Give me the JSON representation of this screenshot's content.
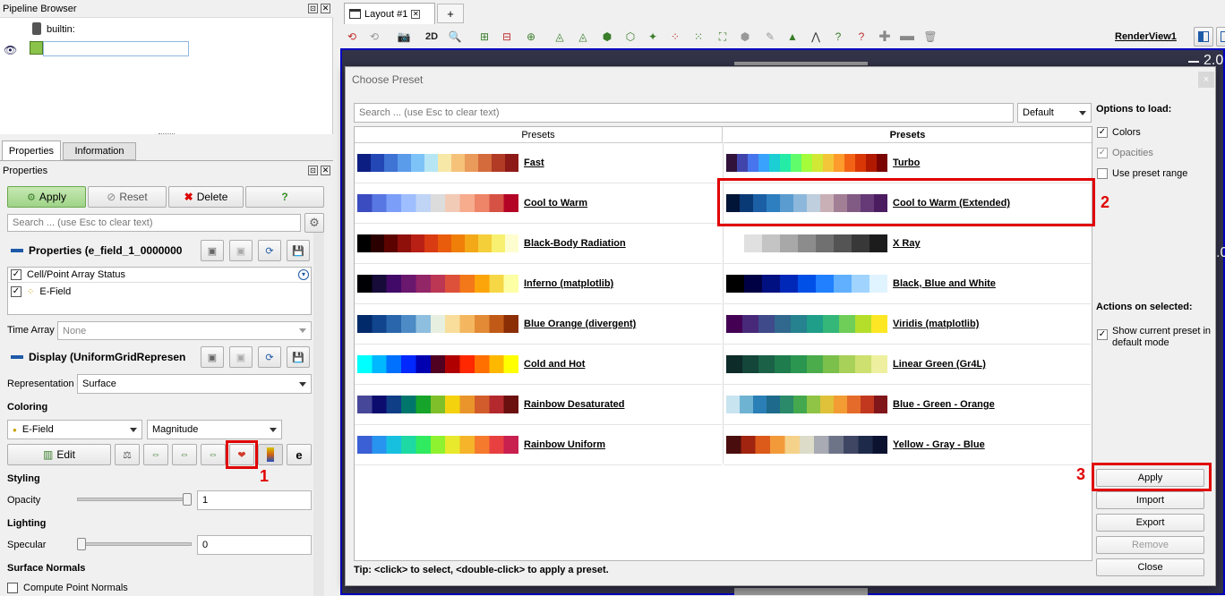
{
  "pipeline": {
    "title": "Pipeline Browser",
    "builtin": "builtin:"
  },
  "tabs": {
    "properties": "Properties",
    "information": "Information"
  },
  "props": {
    "title": "Properties",
    "apply": "Apply",
    "reset": "Reset",
    "delete": "Delete",
    "help": "?",
    "search_placeholder": "Search ... (use Esc to clear text)",
    "section_props": "Properties (e_field_1_0000000",
    "array_status": "Cell/Point Array Status",
    "efield": "E-Field",
    "time_array_label": "Time Array",
    "time_array_value": "None",
    "section_display": "Display (UniformGridRepresen",
    "representation_label": "Representation",
    "representation_value": "Surface",
    "coloring": "Coloring",
    "color_by": "E-Field",
    "component": "Magnitude",
    "edit": "Edit",
    "styling": "Styling",
    "opacity_label": "Opacity",
    "opacity_value": "1",
    "opacity_level": 1.0,
    "lighting": "Lighting",
    "specular_label": "Specular",
    "specular_value": "0",
    "specular_level": 0.0,
    "surface_normals": "Surface Normals",
    "compute_normals": "Compute Point Normals"
  },
  "layout": {
    "tab": "Layout #1",
    "add": "+",
    "mode2d": "2D",
    "renderview": "RenderView1",
    "axis_value": "2.0",
    "side_value": ".0"
  },
  "dialog": {
    "title": "Choose Preset",
    "close": "×",
    "search_placeholder": "Search ... (use Esc to clear text)",
    "filter": "Default",
    "col1": "Presets",
    "col2": "Presets",
    "presets_left": [
      {
        "name": "Fast",
        "colors": [
          "#0d1e82",
          "#2347b5",
          "#3f73d4",
          "#5a9bea",
          "#7ec3f7",
          "#b6e6f4",
          "#f7e8a8",
          "#f6c27a",
          "#ea9a5a",
          "#d46b3c",
          "#b13b25",
          "#8d1a16"
        ]
      },
      {
        "name": "Cool to Warm",
        "colors": [
          "#3b4cc0",
          "#5977e3",
          "#7b9ff9",
          "#9ebeff",
          "#c0d4f5",
          "#dddcdc",
          "#f2cbb7",
          "#f7ac8e",
          "#ee8468",
          "#d65244",
          "#b40426"
        ]
      },
      {
        "name": "Black-Body Radiation",
        "colors": [
          "#000000",
          "#2a0000",
          "#5c0300",
          "#8f0f0a",
          "#b92015",
          "#d93b12",
          "#e95c0b",
          "#f07f09",
          "#f3a818",
          "#f5cf3a",
          "#f8f070",
          "#fdfdd0"
        ]
      },
      {
        "name": "Inferno (matplotlib)",
        "colors": [
          "#000004",
          "#160b39",
          "#420a68",
          "#6a176e",
          "#932667",
          "#bc3754",
          "#dd513a",
          "#f37819",
          "#fca50a",
          "#f6d746",
          "#fcffa4"
        ]
      },
      {
        "name": "Blue Orange (divergent)",
        "colors": [
          "#012a6b",
          "#11458e",
          "#2a66ac",
          "#4d8bc6",
          "#8fbfdf",
          "#e7f0e0",
          "#f8de9a",
          "#f4b760",
          "#e28a36",
          "#c15a16",
          "#8b2e06"
        ]
      },
      {
        "name": "Cold and Hot",
        "colors": [
          "#00ffff",
          "#00b8ff",
          "#0070ff",
          "#0028ff",
          "#0000b0",
          "#500020",
          "#b00000",
          "#ff2800",
          "#ff7000",
          "#ffb800",
          "#ffff00"
        ]
      },
      {
        "name": "Rainbow Desaturated",
        "colors": [
          "#474799",
          "#0c0c6e",
          "#0f3d86",
          "#00756c",
          "#17a42a",
          "#7fbf2a",
          "#f4d20e",
          "#e9952b",
          "#d35c2c",
          "#b3292d",
          "#6b0f0f"
        ]
      },
      {
        "name": "Rainbow Uniform",
        "colors": [
          "#3b5fd4",
          "#2894f0",
          "#18c0e0",
          "#1ed9a4",
          "#30ea5f",
          "#8ff230",
          "#e8e82c",
          "#f5b42a",
          "#f57a2d",
          "#e84040",
          "#c8204f"
        ]
      }
    ],
    "presets_right": [
      {
        "name": "Turbo",
        "colors": [
          "#30123b",
          "#4145ab",
          "#4675ed",
          "#39a2fc",
          "#1bcfd4",
          "#24eca6",
          "#61fc6c",
          "#a4fc3b",
          "#d1e834",
          "#f3c63a",
          "#fe9b2d",
          "#f36315",
          "#d93806",
          "#b11901",
          "#7a0402"
        ]
      },
      {
        "name": "Cool to Warm (Extended)",
        "colors": [
          "#001537",
          "#0a3a75",
          "#1b5fa5",
          "#2e7fc0",
          "#5a9ccf",
          "#8db8db",
          "#bfcfde",
          "#c9b0b6",
          "#a37f96",
          "#825b84",
          "#663a77",
          "#4b1d60"
        ]
      },
      {
        "name": "X Ray",
        "colors": [
          "#ffffff",
          "#e0e0e0",
          "#c4c4c4",
          "#a8a8a8",
          "#8c8c8c",
          "#707070",
          "#545454",
          "#383838",
          "#1c1c1c"
        ]
      },
      {
        "name": "Black, Blue and White",
        "colors": [
          "#000000",
          "#000045",
          "#001080",
          "#0028b8",
          "#0050e8",
          "#2080ff",
          "#60b0ff",
          "#a0d4ff",
          "#e0f4ff"
        ]
      },
      {
        "name": "Viridis (matplotlib)",
        "colors": [
          "#440154",
          "#482878",
          "#3e4a89",
          "#31688e",
          "#26828e",
          "#1f9e89",
          "#35b779",
          "#6ece58",
          "#b5de2b",
          "#fde725"
        ]
      },
      {
        "name": "Linear Green (Gr4L)",
        "colors": [
          "#0d2b28",
          "#14463a",
          "#1a6147",
          "#1f7c4d",
          "#2a9650",
          "#4bac4c",
          "#7bc04a",
          "#a8d15a",
          "#cde070",
          "#eef0a0"
        ]
      },
      {
        "name": "Blue - Green - Orange",
        "colors": [
          "#c8e4f0",
          "#6fb3d3",
          "#2a7fb6",
          "#1e6a8c",
          "#2a8a6a",
          "#44a84e",
          "#8fc446",
          "#e0c13a",
          "#f29c33",
          "#e56b2a",
          "#c2381f",
          "#80161a"
        ]
      },
      {
        "name": "Yellow - Gray - Blue",
        "colors": [
          "#4a0d0d",
          "#a02410",
          "#dc5a1a",
          "#f29a3a",
          "#f4d28a",
          "#dcdcc8",
          "#a8aab4",
          "#6e7488",
          "#3e4664",
          "#1e2a4a",
          "#0a1230"
        ]
      }
    ],
    "options_title": "Options to load:",
    "opt_colors": "Colors",
    "opt_opacities": "Opacities",
    "opt_range": "Use preset range",
    "actions_title": "Actions on selected:",
    "show_default": "Show current preset in default mode",
    "apply": "Apply",
    "import": "Import",
    "export": "Export",
    "remove": "Remove",
    "close_btn": "Close",
    "tip": "Tip: <click> to select, <double-click> to apply a preset."
  },
  "annotations": {
    "n1": "1",
    "n2": "2",
    "n3": "3"
  },
  "colors": {
    "accent_blue": "#0000c0",
    "highlight_red": "#e00000",
    "render_bg": "#333348"
  }
}
